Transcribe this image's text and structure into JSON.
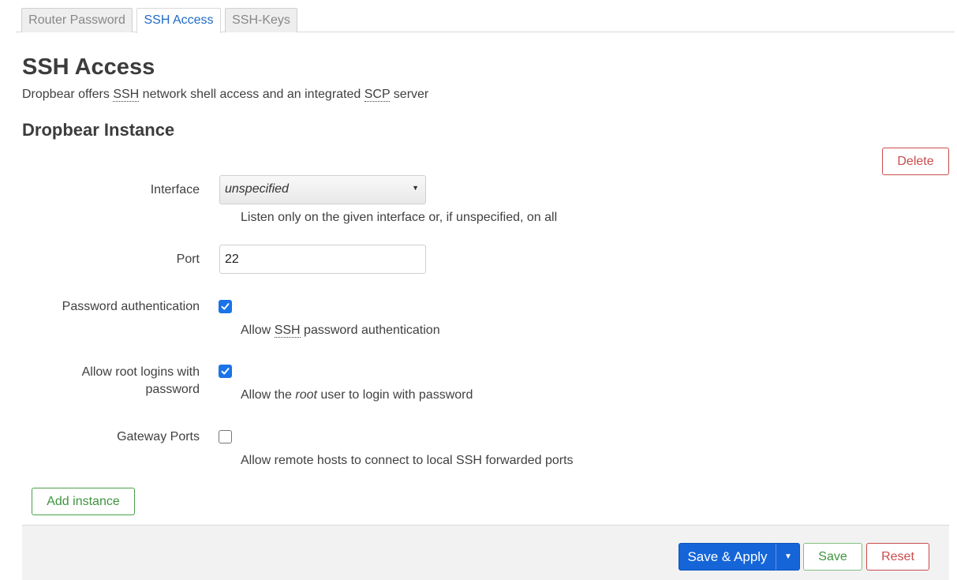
{
  "tabs": [
    {
      "label": "Router Password",
      "active": false
    },
    {
      "label": "SSH Access",
      "active": true
    },
    {
      "label": "SSH-Keys",
      "active": false
    }
  ],
  "page": {
    "title": "SSH Access",
    "description_prefix": "Dropbear offers ",
    "description_abbr1": "SSH",
    "description_mid": " network shell access and an integrated ",
    "description_abbr2": "SCP",
    "description_suffix": " server"
  },
  "section": {
    "title": "Dropbear Instance",
    "delete_label": "Delete",
    "add_label": "Add instance"
  },
  "form": {
    "interface": {
      "label": "Interface",
      "value": "unspecified",
      "description": "Listen only on the given interface or, if unspecified, on all"
    },
    "port": {
      "label": "Port",
      "value": "22"
    },
    "password_auth": {
      "label": "Password authentication",
      "checked": true,
      "desc_prefix": "Allow ",
      "desc_abbr": "SSH",
      "desc_suffix": " password authentication"
    },
    "root_login": {
      "label_line1": "Allow root logins with",
      "label_line2": "password",
      "checked": true,
      "desc_prefix": "Allow the ",
      "desc_em": "root",
      "desc_suffix": " user to login with password"
    },
    "gateway_ports": {
      "label": "Gateway Ports",
      "checked": false,
      "description": "Allow remote hosts to connect to local SSH forwarded ports"
    }
  },
  "footer": {
    "save_apply_label": "Save & Apply",
    "save_label": "Save",
    "reset_label": "Reset"
  },
  "icons": {
    "select_arrow": "triangle-down-icon",
    "dropdown_caret": "caret-down-icon",
    "checkmark": "checkmark-icon"
  },
  "colors": {
    "primary": "#1565d8",
    "danger": "#c94c4c",
    "success": "#3e943e",
    "active_tab": "#1f6bc6"
  }
}
